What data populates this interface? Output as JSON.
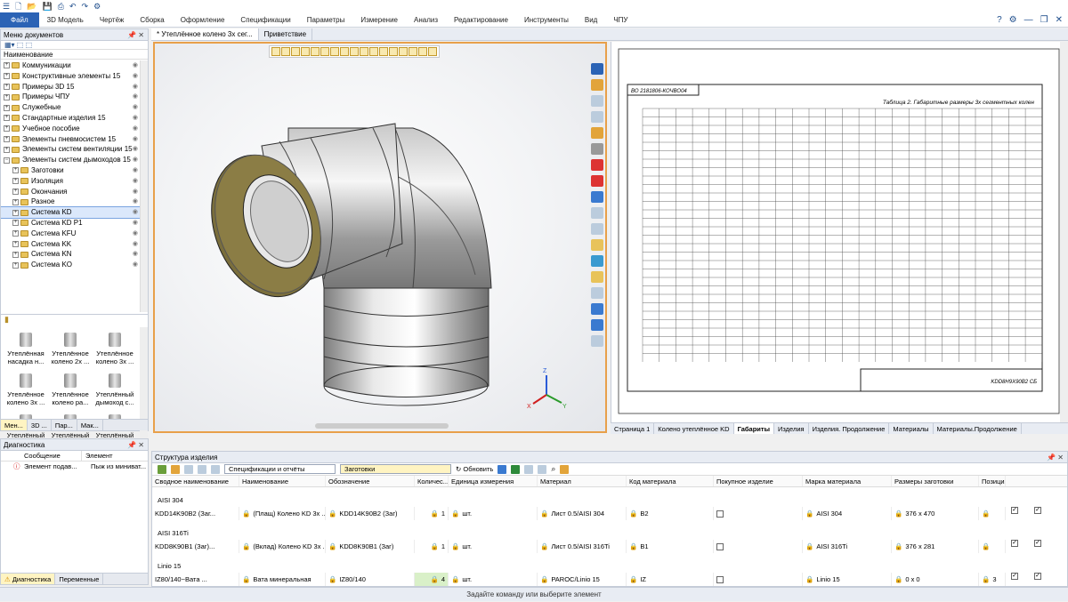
{
  "ribbon": {
    "tabs": [
      "Файл",
      "3D Модель",
      "Чертёж",
      "Сборка",
      "Оформление",
      "Спецификации",
      "Параметры",
      "Измерение",
      "Анализ",
      "Редактирование",
      "Инструменты",
      "Вид",
      "ЧПУ"
    ],
    "active": "Файл"
  },
  "doc_menu": {
    "title": "Меню документов",
    "column_header": "Наименование",
    "tree": [
      {
        "label": "Коммуникации",
        "depth": 0
      },
      {
        "label": "Конструктивные элементы 15",
        "depth": 0
      },
      {
        "label": "Примеры 3D 15",
        "depth": 0
      },
      {
        "label": "Примеры ЧПУ",
        "depth": 0
      },
      {
        "label": "Служебные",
        "depth": 0
      },
      {
        "label": "Стандартные изделия 15",
        "depth": 0
      },
      {
        "label": "Учебное пособие",
        "depth": 0
      },
      {
        "label": "Элементы пневмосистем 15",
        "depth": 0
      },
      {
        "label": "Элементы систем вентиляции 15",
        "depth": 0
      },
      {
        "label": "Элементы систем дымоходов 15",
        "depth": 0,
        "expanded": true
      },
      {
        "label": "Заготовки",
        "depth": 1
      },
      {
        "label": "Изоляция",
        "depth": 1
      },
      {
        "label": "Окончания",
        "depth": 1
      },
      {
        "label": "Разное",
        "depth": 1
      },
      {
        "label": "Система KD",
        "depth": 1,
        "selected": true
      },
      {
        "label": "Система KD P1",
        "depth": 1
      },
      {
        "label": "Система KFU",
        "depth": 1
      },
      {
        "label": "Система KK",
        "depth": 1
      },
      {
        "label": "Система KN",
        "depth": 1
      },
      {
        "label": "Система KO",
        "depth": 1
      }
    ],
    "thumbs": [
      {
        "l1": "Утеплённая",
        "l2": "насадка н..."
      },
      {
        "l1": "Утеплённое",
        "l2": "колено 2х ..."
      },
      {
        "l1": "Утеплённое",
        "l2": "колено 3х ..."
      },
      {
        "l1": "Утеплённое",
        "l2": "колено 3х ..."
      },
      {
        "l1": "Утеплённое",
        "l2": "колено ра..."
      },
      {
        "l1": "Утеплённый",
        "l2": "дымоход с..."
      },
      {
        "l1": "Утеплённый",
        "l2": ""
      },
      {
        "l1": "Утеплённый",
        "l2": ""
      },
      {
        "l1": "Утеплённый",
        "l2": ""
      }
    ],
    "bottom_tabs": [
      "Мен...",
      "3D ...",
      "Пар...",
      "Мак..."
    ]
  },
  "diagnostics": {
    "title": "Диагностика",
    "col_message": "Сообщение",
    "col_element": "Элемент",
    "row_message": "Элемент подав...",
    "row_element": "Пыж из миниват...",
    "bottom_tabs": [
      "Диагностика",
      "Переменные"
    ]
  },
  "doc_tabs": [
    "* Утеплённое колено 3х сег...",
    "Приветствие"
  ],
  "drawing": {
    "doc_code": "ВО 2181806-КОЧВО04",
    "table_title": "Таблица 2. Габаритные размеры 3х сегментных колен",
    "stamp_code": "KDD8H9X90B2 СБ",
    "tabs": [
      "Страница 1",
      "Колено утеплённое KD",
      "Габариты",
      "Изделия",
      "Изделия. Продолжение",
      "Материалы",
      "Материалы.Продолжение"
    ],
    "active_tab": "Габариты"
  },
  "structure": {
    "title": "Структура изделия",
    "combo_reports": "Спецификации и отчёты",
    "combo_blanks": "Заготовки",
    "refresh_label": "Обновить",
    "columns": [
      "Сводное наименование",
      "Наименование",
      "Обозначение",
      "Количес...",
      "Единица измерения",
      "Материал",
      "Код материала",
      "Покупное изделие",
      "Марка материала",
      "Размеры заготовки",
      "Позиция"
    ],
    "groups": [
      {
        "name": "AISI 304",
        "row": {
          "summary": "KDD14K90B2 (Заг...",
          "name": "(Плащ) Колено KD 3х ...",
          "designation": "KDD14K90B2 (Заг)",
          "qty": "1",
          "unit": "шт.",
          "material": "Лист 0.5/AISI 304",
          "code": "В2",
          "grade": "AISI 304",
          "size": "376 x 470",
          "pos": ""
        }
      },
      {
        "name": "AISI 316Ti",
        "row": {
          "summary": "KDD8K90B1 (Заг)...",
          "name": "(Вклад) Колено KD 3х ...",
          "designation": "KDD8K90B1 (Заг)",
          "qty": "1",
          "unit": "шт.",
          "material": "Лист 0.5/AISI 316Ti",
          "code": "В1",
          "grade": "AISI 316Ti",
          "size": "376 x 281",
          "pos": ""
        }
      },
      {
        "name": "Linio 15",
        "row": {
          "summary": "IZ80/140~Вата ...",
          "name": "Вата минеральная",
          "designation": "IZ80/140",
          "qty": "4",
          "unit": "шт.",
          "material": "PAROC/Linio 15",
          "code": "IZ",
          "grade": "Linio 15",
          "size": "0 x 0",
          "pos": "3"
        }
      }
    ]
  },
  "status_text": "Задайте команду или выберите элемент"
}
